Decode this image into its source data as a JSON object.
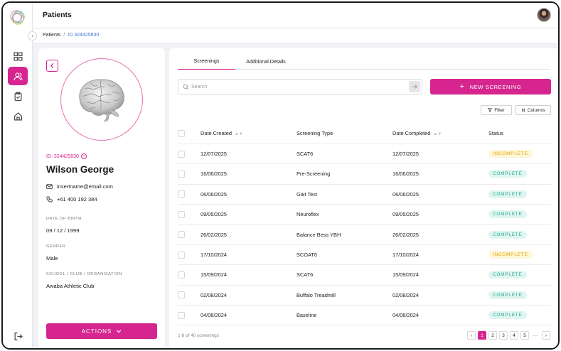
{
  "header": {
    "title": "Patients"
  },
  "breadcrumb": {
    "root": "Patients",
    "separator": "/",
    "current": "ID 324425830"
  },
  "patient": {
    "id_label": "ID: 324425830",
    "name": "Wilson George",
    "email": "insertname@email.com",
    "phone": "+61 400 192 384",
    "fields": [
      {
        "label": "DATE OF BIRTH",
        "value": "09 / 12 / 1999"
      },
      {
        "label": "GENDER",
        "value": "Male"
      },
      {
        "label": "SCHOOL / CLUB / ORGANISATION",
        "value": "Awaba Athletic Club"
      }
    ],
    "actions_label": "ACTIONS"
  },
  "tabs": [
    {
      "label": "Screenings"
    },
    {
      "label": "Additional Details"
    }
  ],
  "search": {
    "placeholder": "Search"
  },
  "new_screening_label": "NEW SCREENING",
  "filter_label": "Filter",
  "columns_label": "Columns",
  "table": {
    "headers": [
      "Date Created",
      "Screening Type",
      "Date Completed",
      "Status"
    ],
    "rows": [
      {
        "created": "12/07/2025",
        "type": "SCAT6",
        "completed": "12/07/2025",
        "status": "INCOMPLETE"
      },
      {
        "created": "16/06/2025",
        "type": "Pre-Screening",
        "completed": "16/06/2025",
        "status": "COMPLETE"
      },
      {
        "created": "06/06/2025",
        "type": "Gait Test",
        "completed": "06/06/2025",
        "status": "COMPLETE"
      },
      {
        "created": "09/05/2025",
        "type": "Neuroflex",
        "completed": "09/05/2025",
        "status": "COMPLETE"
      },
      {
        "created": "26/02/2025",
        "type": "Balance Bess YBH",
        "completed": "26/02/2025",
        "status": "COMPLETE"
      },
      {
        "created": "17/10/2024",
        "type": "SCOAT6",
        "completed": "17/10/2024",
        "status": "INCOMPLETE"
      },
      {
        "created": "15/09/2024",
        "type": "SCAT6",
        "completed": "15/09/2024",
        "status": "COMPLETE"
      },
      {
        "created": "02/08/2024",
        "type": "Buffalo Treadmill",
        "completed": "02/08/2024",
        "status": "COMPLETE"
      },
      {
        "created": "04/08/2024",
        "type": "Baseline",
        "completed": "04/08/2024",
        "status": "COMPLETE"
      }
    ]
  },
  "pagination": {
    "summary": "1-8 of 40 screenings",
    "pages": [
      "1",
      "2",
      "3",
      "4",
      "5"
    ],
    "ellipsis": "···",
    "current": "1"
  },
  "icons": [
    "logo-icon",
    "dashboard-icon",
    "users-icon",
    "clipboard-icon",
    "home-icon",
    "logout-icon",
    "chevron-left-icon",
    "verified-icon",
    "mail-icon",
    "phone-icon",
    "chevron-down-icon",
    "search-icon",
    "arrow-right-icon",
    "plus-icon",
    "filter-icon",
    "columns-icon",
    "sort-icon"
  ],
  "colors": {
    "accent": "#d6258f",
    "complete_bg": "#dff5f1",
    "complete_text": "#2aa892",
    "incomplete_bg": "#fff6d6",
    "incomplete_text": "#e0a300"
  }
}
